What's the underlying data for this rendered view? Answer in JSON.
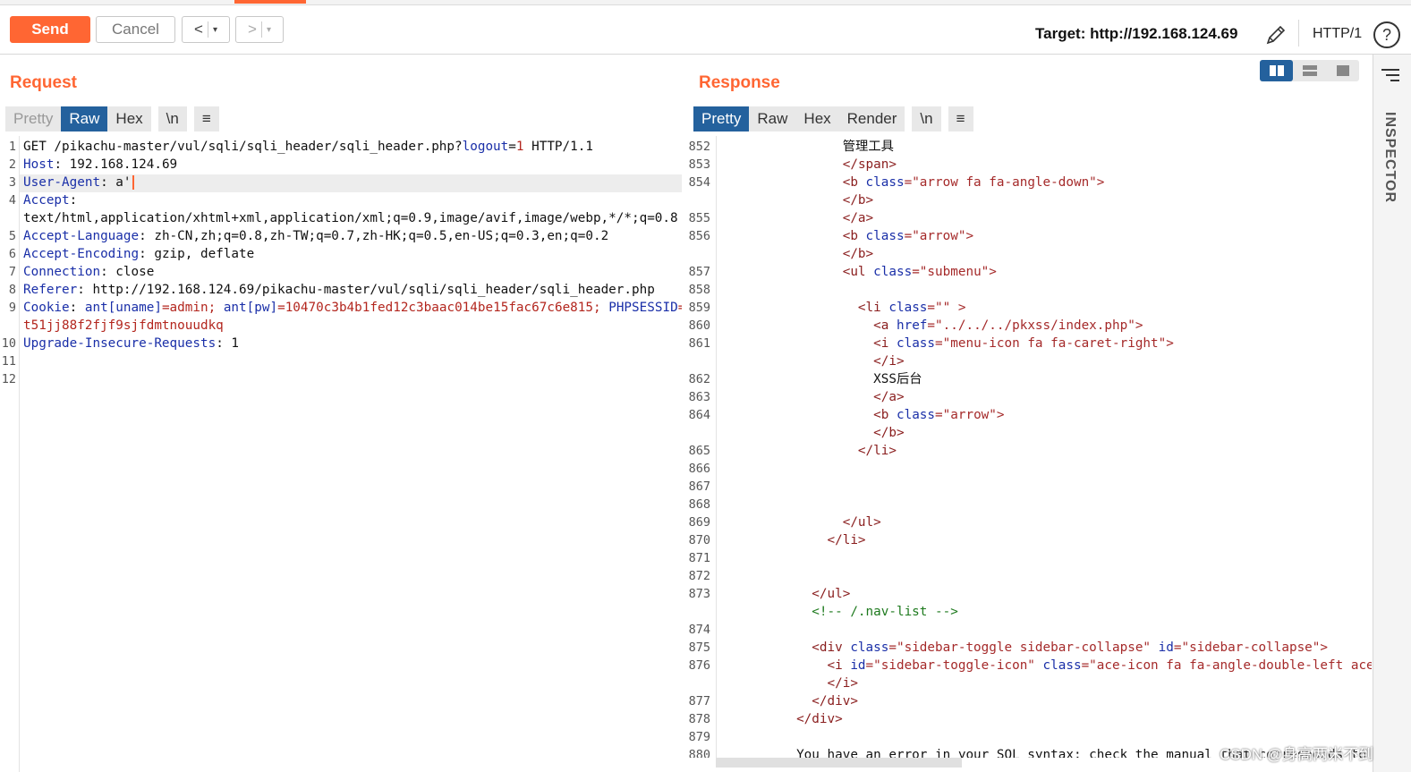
{
  "toolbar": {
    "send_label": "Send",
    "cancel_label": "Cancel",
    "back_label": "<",
    "forward_label": ">",
    "dropdown_glyph": "▾",
    "target_label": "Target: http://192.168.124.69",
    "http_version": "HTTP/1",
    "help_glyph": "?",
    "accent_color": "#ff6633"
  },
  "request": {
    "title": "Request",
    "tabs": [
      "Pretty",
      "Raw",
      "Hex",
      "\\n",
      "≡"
    ],
    "active_tab": "Raw",
    "line_numbers": [
      "1",
      "2",
      "3",
      "4",
      "",
      "5",
      "6",
      "7",
      "8",
      "9",
      "",
      "10",
      "11",
      "12"
    ],
    "lines": [
      [
        {
          "t": "GET /pikachu-master/vul/sqli/sqli_header/sqli_header.php?",
          "c": "hv"
        },
        {
          "t": "logout",
          "c": "pk"
        },
        {
          "t": "=",
          "c": "hv"
        },
        {
          "t": "1",
          "c": "pv"
        },
        {
          "t": " HTTP/1.1",
          "c": "hv"
        }
      ],
      [
        {
          "t": "Host",
          "c": "hn"
        },
        {
          "t": ": 192.168.124.69",
          "c": "hv"
        }
      ],
      [
        {
          "t": "User-Agent",
          "c": "hn"
        },
        {
          "t": ": a'",
          "c": "hv"
        }
      ],
      [
        {
          "t": "Accept",
          "c": "hn"
        },
        {
          "t": ":",
          "c": "hv"
        }
      ],
      [
        {
          "t": "text/html,application/xhtml+xml,application/xml;q=0.9,image/avif,image/webp,*/*;q=0.8",
          "c": "hv"
        }
      ],
      [
        {
          "t": "Accept-Language",
          "c": "hn"
        },
        {
          "t": ": zh-CN,zh;q=0.8,zh-TW;q=0.7,zh-HK;q=0.5,en-US;q=0.3,en;q=0.2",
          "c": "hv"
        }
      ],
      [
        {
          "t": "Accept-Encoding",
          "c": "hn"
        },
        {
          "t": ": gzip, deflate",
          "c": "hv"
        }
      ],
      [
        {
          "t": "Connection",
          "c": "hn"
        },
        {
          "t": ": close",
          "c": "hv"
        }
      ],
      [
        {
          "t": "Referer",
          "c": "hn"
        },
        {
          "t": ": http://192.168.124.69/pikachu-master/vul/sqli/sqli_header/sqli_header.php",
          "c": "hv"
        }
      ],
      [
        {
          "t": "Cookie",
          "c": "hn"
        },
        {
          "t": ": ",
          "c": "hv"
        },
        {
          "t": "ant[uname]",
          "c": "pk"
        },
        {
          "t": "=admin; ",
          "c": "pv"
        },
        {
          "t": "ant[pw]",
          "c": "pk"
        },
        {
          "t": "=10470c3b4b1fed12c3baac014be15fac67c6e815; ",
          "c": "pv"
        },
        {
          "t": "PHPSESSID",
          "c": "pk"
        },
        {
          "t": "=",
          "c": "pv"
        }
      ],
      [
        {
          "t": "t51jj88f2fjf9sjfdmtnouudkq",
          "c": "pv"
        }
      ],
      [
        {
          "t": "Upgrade-Insecure-Requests",
          "c": "hn"
        },
        {
          "t": ": 1",
          "c": "hv"
        }
      ],
      [],
      []
    ]
  },
  "response": {
    "title": "Response",
    "tabs": [
      "Pretty",
      "Raw",
      "Hex",
      "Render",
      "\\n",
      "≡"
    ],
    "active_tab": "Pretty",
    "line_numbers": [
      "852",
      "853",
      "854",
      "",
      "855",
      "856",
      "",
      "857",
      "858",
      "859",
      "860",
      "861",
      "",
      "862",
      "863",
      "864",
      "",
      "865",
      "866",
      "867",
      "868",
      "869",
      "870",
      "871",
      "872",
      "873",
      "",
      "874",
      "875",
      "876",
      "",
      "877",
      "878",
      "879",
      "880"
    ],
    "lines": [
      [
        {
          "t": "                管理工具",
          "c": "hv"
        }
      ],
      [
        {
          "t": "                </",
          "c": "tg"
        },
        {
          "t": "span",
          "c": "tg"
        },
        {
          "t": ">",
          "c": "tg"
        }
      ],
      [
        {
          "t": "                <b ",
          "c": "tg"
        },
        {
          "t": "class",
          "c": "an"
        },
        {
          "t": "=\"arrow fa fa-angle-down\">",
          "c": "av"
        }
      ],
      [
        {
          "t": "                </b>",
          "c": "tg"
        }
      ],
      [
        {
          "t": "                </a>",
          "c": "tg"
        }
      ],
      [
        {
          "t": "                <b ",
          "c": "tg"
        },
        {
          "t": "class",
          "c": "an"
        },
        {
          "t": "=\"arrow\">",
          "c": "av"
        }
      ],
      [
        {
          "t": "                </b>",
          "c": "tg"
        }
      ],
      [
        {
          "t": "                <ul ",
          "c": "tg"
        },
        {
          "t": "class",
          "c": "an"
        },
        {
          "t": "=\"submenu\">",
          "c": "av"
        }
      ],
      [],
      [
        {
          "t": "                  <li ",
          "c": "tg"
        },
        {
          "t": "class",
          "c": "an"
        },
        {
          "t": "=\"\" >",
          "c": "av"
        }
      ],
      [
        {
          "t": "                    <a ",
          "c": "tg"
        },
        {
          "t": "href",
          "c": "an"
        },
        {
          "t": "=\"../../../pkxss/index.php\">",
          "c": "av"
        }
      ],
      [
        {
          "t": "                    <i ",
          "c": "tg"
        },
        {
          "t": "class",
          "c": "an"
        },
        {
          "t": "=\"menu-icon fa fa-caret-right\">",
          "c": "av"
        }
      ],
      [
        {
          "t": "                    </i>",
          "c": "tg"
        }
      ],
      [
        {
          "t": "                    XSS后台",
          "c": "hv"
        }
      ],
      [
        {
          "t": "                    </a>",
          "c": "tg"
        }
      ],
      [
        {
          "t": "                    <b ",
          "c": "tg"
        },
        {
          "t": "class",
          "c": "an"
        },
        {
          "t": "=\"arrow\">",
          "c": "av"
        }
      ],
      [
        {
          "t": "                    </b>",
          "c": "tg"
        }
      ],
      [
        {
          "t": "                  </li>",
          "c": "tg"
        }
      ],
      [],
      [],
      [],
      [
        {
          "t": "                </ul>",
          "c": "tg"
        }
      ],
      [
        {
          "t": "              </li>",
          "c": "tg"
        }
      ],
      [],
      [],
      [
        {
          "t": "            </ul>",
          "c": "tg"
        }
      ],
      [
        {
          "t": "            <!-- /.nav-list -->",
          "c": "cm"
        }
      ],
      [],
      [
        {
          "t": "            <div ",
          "c": "tg"
        },
        {
          "t": "class",
          "c": "an"
        },
        {
          "t": "=\"sidebar-toggle sidebar-collapse\" ",
          "c": "av"
        },
        {
          "t": "id",
          "c": "an"
        },
        {
          "t": "=\"sidebar-collapse\">",
          "c": "av"
        }
      ],
      [
        {
          "t": "              <i ",
          "c": "tg"
        },
        {
          "t": "id",
          "c": "an"
        },
        {
          "t": "=\"sidebar-toggle-icon\" ",
          "c": "av"
        },
        {
          "t": "class",
          "c": "an"
        },
        {
          "t": "=\"ace-icon fa fa-angle-double-left ace-save",
          "c": "av"
        }
      ],
      [
        {
          "t": "              </i>",
          "c": "tg"
        }
      ],
      [
        {
          "t": "            </div>",
          "c": "tg"
        }
      ],
      [
        {
          "t": "          </div>",
          "c": "tg"
        }
      ],
      [],
      [
        {
          "t": "          You have an error in your SQL syntax; check the manual that corresponds to your",
          "c": "hv"
        }
      ]
    ]
  },
  "layout_buttons": [
    "split-horizontal-icon",
    "split-vertical-icon",
    "single-pane-icon"
  ],
  "inspector": {
    "label": "INSPECTOR"
  },
  "watermark": "CSDN @身高两米不到"
}
